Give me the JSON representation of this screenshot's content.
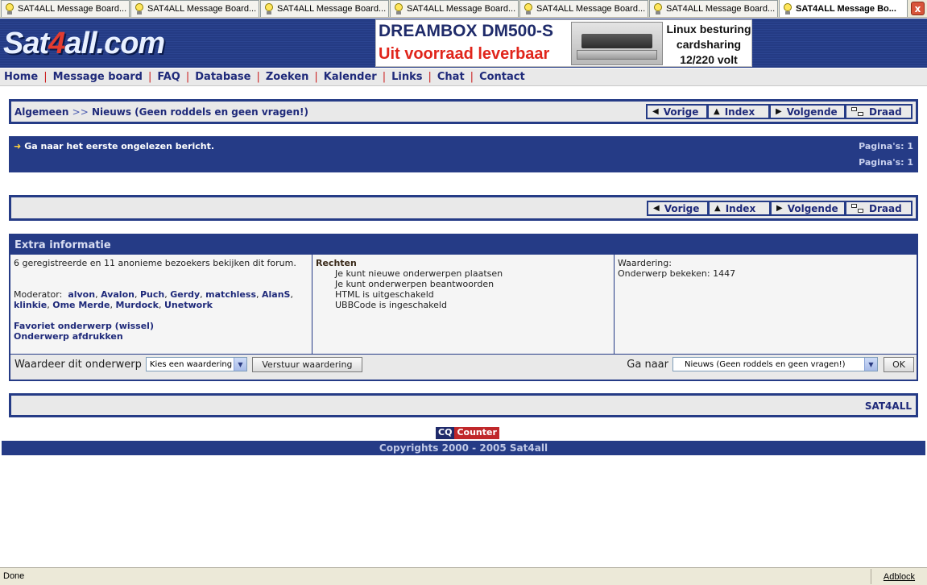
{
  "tabs": [
    {
      "label": "SAT4ALL Message Board..."
    },
    {
      "label": "SAT4ALL Message Board..."
    },
    {
      "label": "SAT4ALL Message Board..."
    },
    {
      "label": "SAT4ALL Message Board..."
    },
    {
      "label": "SAT4ALL Message Board..."
    },
    {
      "label": "SAT4ALL Message Board..."
    },
    {
      "label": "SAT4ALL Message Bo..."
    }
  ],
  "close_glyph": "x",
  "logo": {
    "pre": "Sat",
    "four": "4",
    "post": "all.com"
  },
  "banner": {
    "line1": "DREAMBOX DM500-S",
    "line2": "Uit voorraad leverbaar",
    "right": [
      "Linux besturing",
      "cardsharing",
      "12/220 volt"
    ]
  },
  "nav": [
    "Home",
    "Message board",
    "FAQ",
    "Database",
    "Zoeken",
    "Kalender",
    "Links",
    "Chat",
    "Contact"
  ],
  "nav_sep": "|",
  "breadcrumb": {
    "root": "Algemeen",
    "sep": ">>",
    "current": "Nieuws (Geen roddels en geen vragen!)"
  },
  "navbuttons": {
    "prev": "Vorige",
    "index": "Index",
    "next": "Volgende",
    "thread": "Draad"
  },
  "unread": {
    "goto": "Ga naar het eerste ongelezen bericht.",
    "pages1": "Pagina's: 1",
    "pages2": "Pagina's: 1"
  },
  "extra": {
    "title": "Extra informatie",
    "viewers": "6 geregistreerde en 11 anonieme bezoekers bekijken dit forum.",
    "moderator_label": "Moderator:",
    "moderators": [
      "alvon",
      "Avalon",
      "Puch",
      "Gerdy",
      "matchless",
      "AlanS",
      "klinkie",
      "Ome Merde",
      "Murdock",
      "Unetwork"
    ],
    "favorite": "Favoriet onderwerp (wissel)",
    "print": "Onderwerp afdrukken",
    "rights_title": "Rechten",
    "rights": [
      "Je kunt nieuwe onderwerpen plaatsen",
      "Je kunt onderwerpen beantwoorden",
      "HTML is uitgeschakeld",
      "UBBCode is ingeschakeld"
    ],
    "rating_label": "Waardering:",
    "views_label": "Onderwerp bekeken: 1447",
    "rate_label": "Waardeer dit onderwerp",
    "rate_select": "Kies een waardering",
    "rate_submit": "Verstuur waardering",
    "goto_label": "Ga naar",
    "goto_select": "Nieuws (Geen roddels en geen vragen!)",
    "ok": "OK"
  },
  "footer_brand": "SAT4ALL",
  "counter": {
    "cq": "CQ",
    "text": "Counter"
  },
  "copyright": "Copyrights 2000 - 2005 Sat4all",
  "status": {
    "text": "Done",
    "adblock": "Adblock"
  }
}
